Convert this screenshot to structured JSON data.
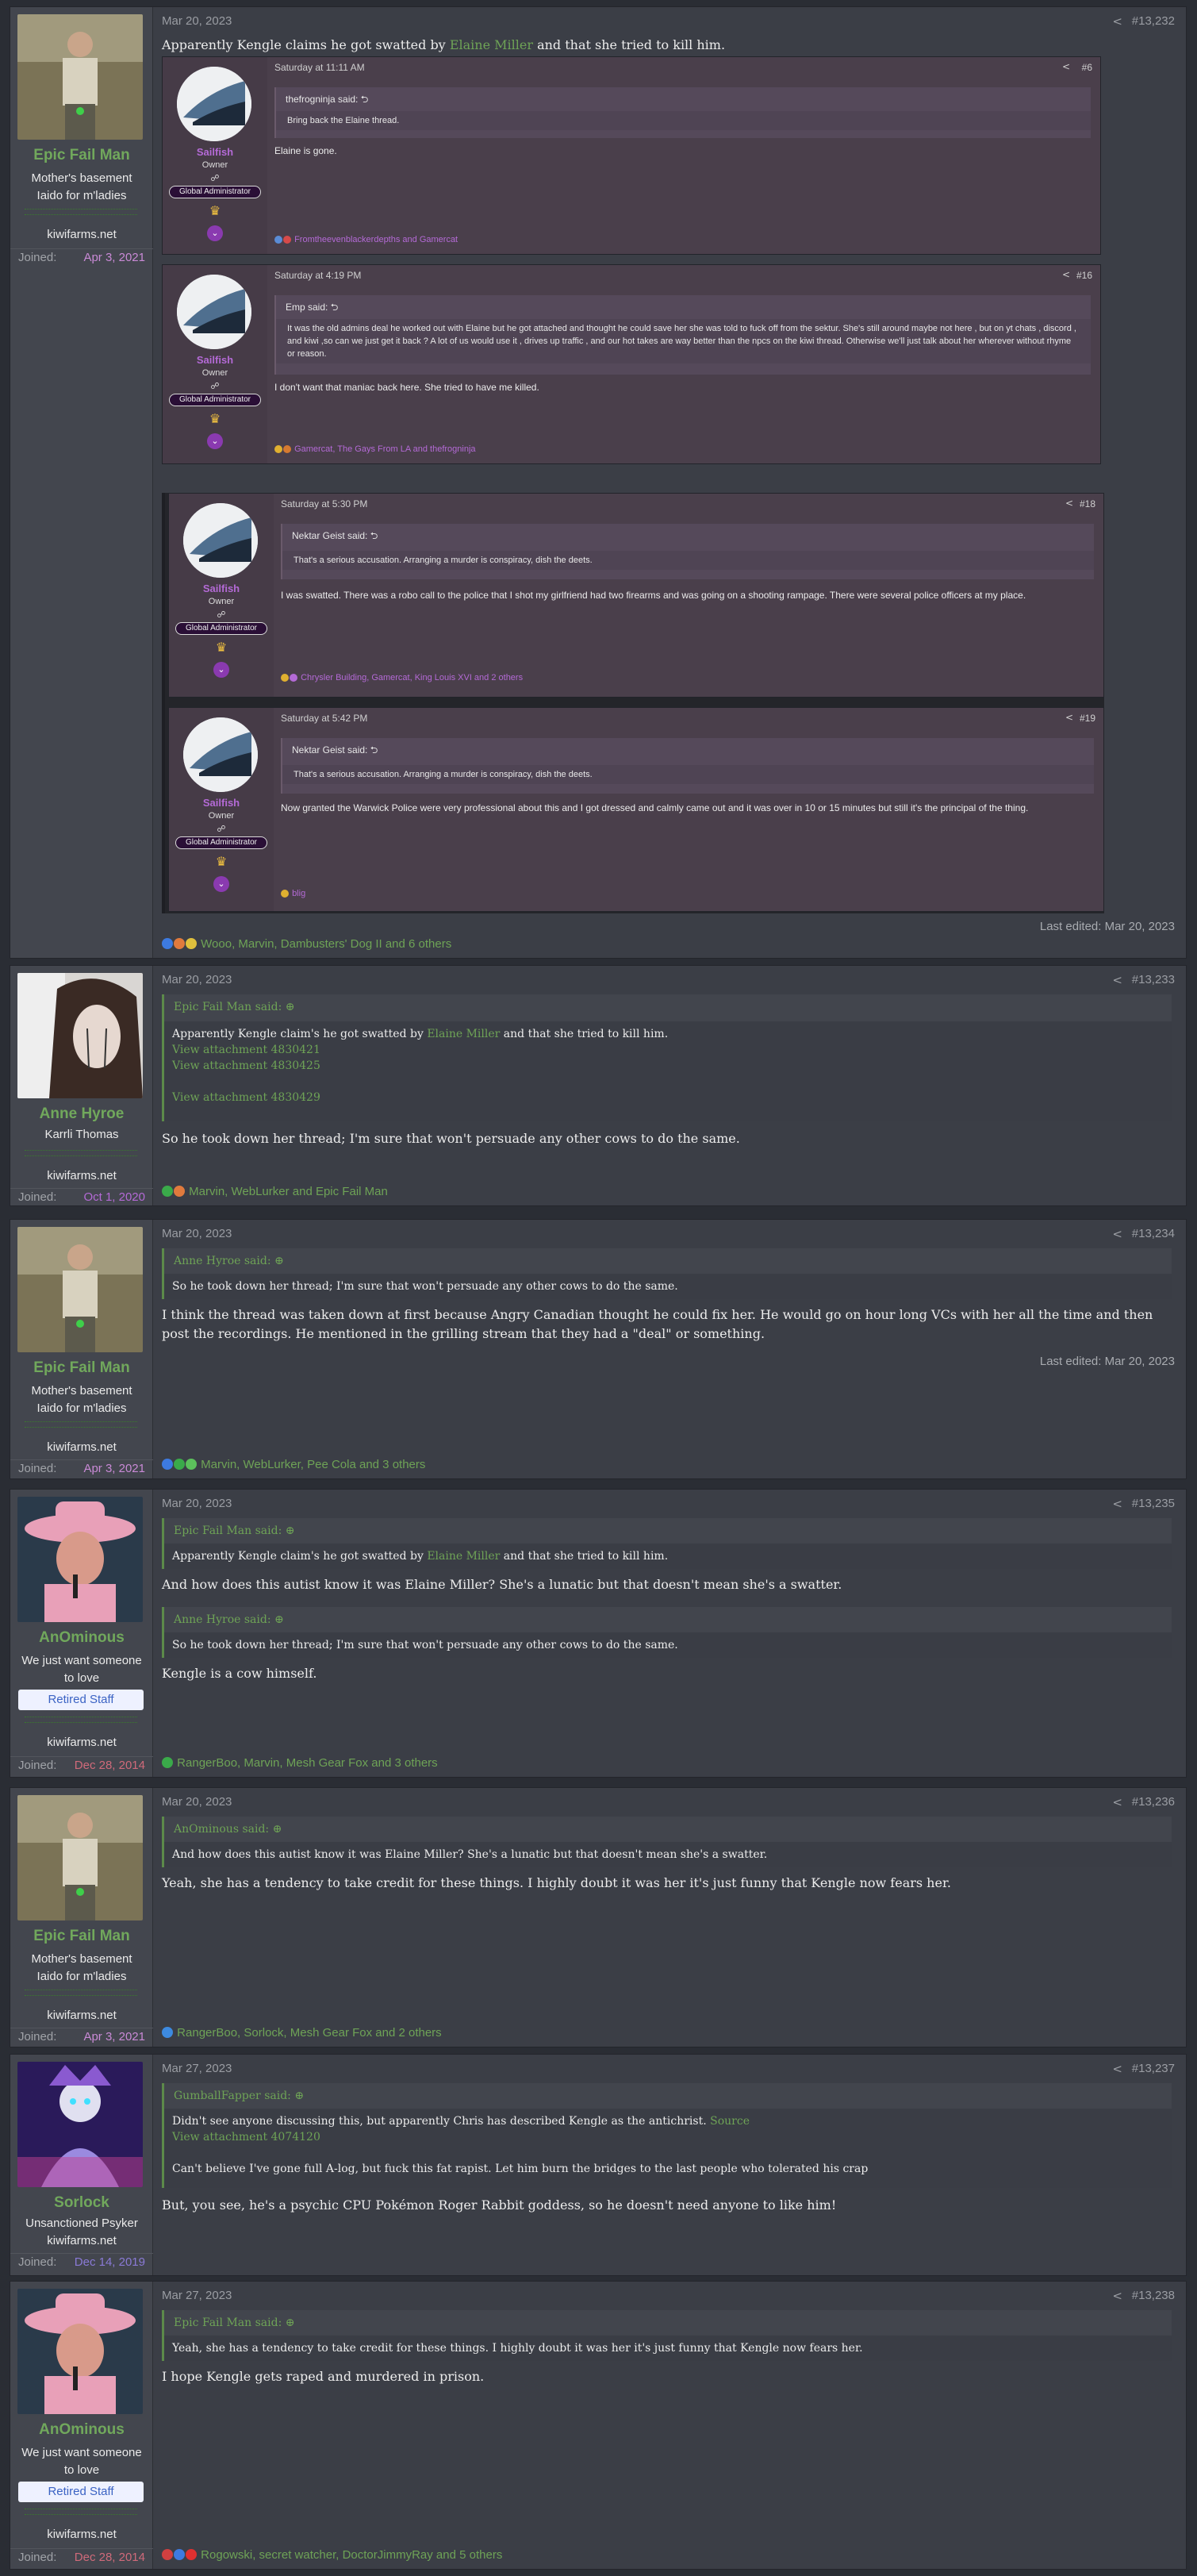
{
  "common": {
    "joined_label": "Joined:",
    "quote_suffix": " said: ⊕",
    "share_icon": "share-icon"
  },
  "posts": [
    {
      "date": "Mar 20, 2023",
      "number": "#13,232",
      "user": {
        "name": "Epic Fail Man",
        "title": "Mother's basement Iaido for m'ladies",
        "site": "kiwifarms.net",
        "joined": "Apr 3, 2021"
      },
      "text_before": "Apparently Kengle claims he got swatted by ",
      "text_link": "Elaine Miller",
      "text_after": " and that she tried to kill him.",
      "edited": "Last edited: Mar 20, 2023",
      "reactions": "Wooo, Marvin, Dambusters' Dog II and 6 others"
    },
    {
      "date": "Mar 20, 2023",
      "number": "#13,233",
      "user": {
        "name": "Anne Hyroe",
        "title": "Karrli Thomas",
        "site": "kiwifarms.net",
        "joined": "Oct 1, 2020"
      },
      "quote": {
        "author": "Epic Fail Man",
        "text_before": "Apparently Kengle claim's he got swatted by ",
        "text_link": "Elaine Miller",
        "text_after": " and that she tried to kill him.",
        "att1": "View attachment 4830421",
        "att2": "View attachment 4830425",
        "att3": "View attachment 4830429"
      },
      "text": "So he took down her thread; I'm sure that won't persuade any other cows to do the same.",
      "reactions": "Marvin, WebLurker and Epic Fail Man"
    },
    {
      "date": "Mar 20, 2023",
      "number": "#13,234",
      "user": {
        "name": "Epic Fail Man",
        "title": "Mother's basement Iaido for m'ladies",
        "site": "kiwifarms.net",
        "joined": "Apr 3, 2021"
      },
      "quote": {
        "author": "Anne Hyroe",
        "text": "So he took down her thread; I'm sure that won't persuade any other cows to do the same."
      },
      "text": "I think the thread was taken down at first because Angry Canadian thought he could fix her. He would go on hour long VCs with her all the time and then post the recordings. He mentioned in the grilling stream that they had a \"deal\" or something.",
      "edited": "Last edited: Mar 20, 2023",
      "reactions": "Marvin, WebLurker, Pee Cola and 3 others"
    },
    {
      "date": "Mar 20, 2023",
      "number": "#13,235",
      "user": {
        "name": "AnOminous",
        "title": "We just want someone to love",
        "banner": "Retired Staff",
        "site": "kiwifarms.net",
        "joined": "Dec 28, 2014"
      },
      "quote1": {
        "author": "Epic Fail Man",
        "text_before": "Apparently Kengle claim's he got swatted by ",
        "text_link": "Elaine Miller",
        "text_after": " and that she tried to kill him."
      },
      "text1": "And how does this autist know it was Elaine Miller? She's a lunatic but that doesn't mean she's a swatter.",
      "quote2": {
        "author": "Anne Hyroe",
        "text": "So he took down her thread; I'm sure that won't persuade any other cows to do the same."
      },
      "text2": "Kengle is a cow himself.",
      "reactions": "RangerBoo, Marvin, Mesh Gear Fox and 3 others"
    },
    {
      "date": "Mar 20, 2023",
      "number": "#13,236",
      "user": {
        "name": "Epic Fail Man",
        "title": "Mother's basement Iaido for m'ladies",
        "site": "kiwifarms.net",
        "joined": "Apr 3, 2021"
      },
      "quote": {
        "author": "AnOminous",
        "text": "And how does this autist know it was Elaine Miller? She's a lunatic but that doesn't mean she's a swatter."
      },
      "text": "Yeah, she has a tendency to take credit for these things. I highly doubt it was her it's just funny that Kengle now fears her.",
      "reactions": "RangerBoo, Sorlock, Mesh Gear Fox and 2 others"
    },
    {
      "date": "Mar 27, 2023",
      "number": "#13,237",
      "user": {
        "name": "Sorlock",
        "title": "Unsanctioned Psyker",
        "site": "kiwifarms.net",
        "joined": "Dec 14, 2019"
      },
      "quote": {
        "author": "GumballFapper",
        "text_before": "Didn't see anyone discussing this, but apparently Chris has described Kengle as the antichrist. ",
        "text_link": "Source",
        "att1": "View attachment 4074120",
        "text2": "Can't believe I've gone full A-log, but fuck this fat rapist. Let him burn the bridges to the last people who tolerated his crap"
      },
      "text": "But, you see, he's a psychic CPU Pokémon Roger Rabbit goddess, so he doesn't need anyone to like him!"
    },
    {
      "date": "Mar 27, 2023",
      "number": "#13,238",
      "user": {
        "name": "AnOminous",
        "title": "We just want someone to love",
        "banner": "Retired Staff",
        "site": "kiwifarms.net",
        "joined": "Dec 28, 2014"
      },
      "quote": {
        "author": "Epic Fail Man",
        "text": "Yeah, she has a tendency to take credit for these things. I highly doubt it was her it's just funny that Kengle now fears her."
      },
      "text": "I hope Kengle gets raped and murdered in prison.",
      "reactions": "Rogowski, secret watcher, DoctorJimmyRay and 5 others"
    }
  ],
  "embeds": [
    {
      "name": "Sailfish",
      "role": "Owner",
      "badge": "Global Administrator",
      "time": "Saturday at 11:11 AM",
      "num": "#6",
      "quote_author": "thefrogninja said: ⮌",
      "quote_text": "Bring back the Elaine thread.",
      "text": "Elaine is gone.",
      "reactions": "Fromtheevenblackerdepths and Gamercat"
    },
    {
      "name": "Sailfish",
      "role": "Owner",
      "badge": "Global Administrator",
      "time": "Saturday at 4:19 PM",
      "num": "#16",
      "quote_author": "Emp said: ⮌",
      "quote_text": "It was the old admins deal he worked out with Elaine but he got attached and thought he could save her she was told to fuck off from the sektur. She's still around maybe not here , but on yt chats , discord , and kiwi ,so can we just get it back ? A lot of us would use it , drives up traffic , and our hot takes are way better than the npcs on the kiwi thread. Otherwise we'll just talk about her wherever without rhyme or reason.",
      "text": "I don't want that maniac back here. She tried to have me killed.",
      "reactions": "Gamercat, The Gays From LA and thefrogninja"
    },
    {
      "name": "Sailfish",
      "role": "Owner",
      "badge": "Global Administrator",
      "time": "Saturday at 5:30 PM",
      "num": "#18",
      "quote_author": "Nektar Geist said: ⮌",
      "quote_text": "That's a serious accusation. Arranging a murder is conspiracy, dish the deets.",
      "text": "I was swatted. There was a robo call to the police that I shot my girlfriend had two firearms and was going on a shooting rampage. There were several police officers at my place.",
      "reactions": "Chrysler Building, Gamercat, King Louis XVI and 2 others"
    },
    {
      "name": "Sailfish",
      "role": "Owner",
      "badge": "Global Administrator",
      "time": "Saturday at 5:42 PM",
      "num": "#19",
      "quote_author": "Nektar Geist said: ⮌",
      "quote_text": "That's a serious accusation. Arranging a murder is conspiracy, dish the deets.",
      "text": "Now granted the Warwick Police were very professional about this and I got dressed and calmly came out and it was over in 10 or 15 minutes but still it's the principal of the thing.",
      "reactions": "blig"
    }
  ]
}
